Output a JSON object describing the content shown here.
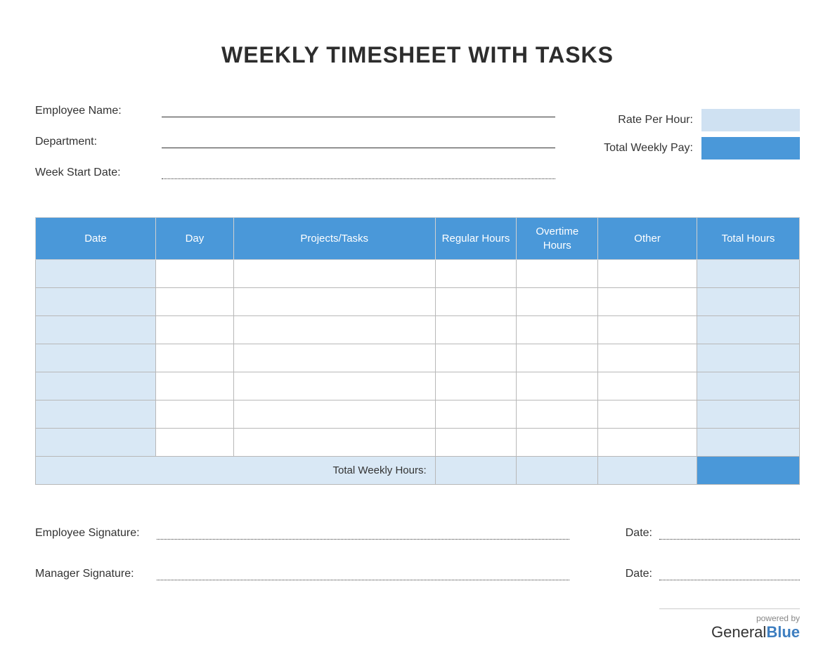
{
  "title": "WEEKLY TIMESHEET WITH TASKS",
  "fields": {
    "employee_name_label": "Employee Name:",
    "department_label": "Department:",
    "week_start_label": "Week Start Date:",
    "rate_label": "Rate Per Hour:",
    "total_pay_label": "Total Weekly Pay:"
  },
  "columns": {
    "date": "Date",
    "day": "Day",
    "tasks": "Projects/Tasks",
    "regular": "Regular Hours",
    "overtime": "Overtime Hours",
    "other": "Other",
    "total": "Total Hours"
  },
  "totals_row_label": "Total Weekly Hours:",
  "signatures": {
    "employee": "Employee Signature:",
    "manager": "Manager Signature:",
    "date": "Date:"
  },
  "footer": {
    "powered": "powered by",
    "brand_general": "General",
    "brand_blue": "Blue"
  }
}
